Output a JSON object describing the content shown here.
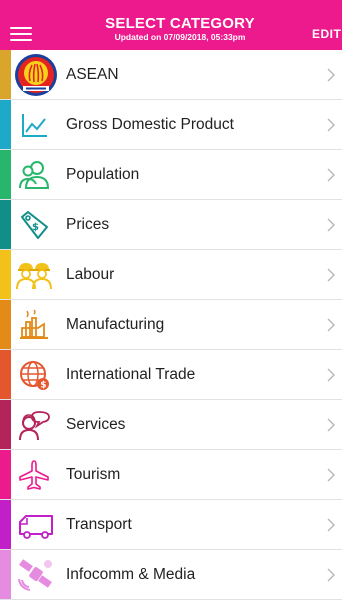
{
  "header": {
    "title": "SELECT CATEGORY",
    "subtitle": "Updated on 07/09/2018, 05:33pm",
    "edit_label": "EDIT",
    "menu_icon": "hamburger-menu-icon",
    "background": "#ec1a8c"
  },
  "categories": [
    {
      "label": "ASEAN",
      "icon": "asean-logo-icon",
      "accent": "#d9a62b"
    },
    {
      "label": "Gross Domestic Product",
      "icon": "line-chart-icon",
      "accent": "#1fa9c9"
    },
    {
      "label": "Population",
      "icon": "people-icon",
      "accent": "#27b66b"
    },
    {
      "label": "Prices",
      "icon": "price-tag-icon",
      "accent": "#0f8f88"
    },
    {
      "label": "Labour",
      "icon": "workers-icon",
      "accent": "#f2c21b"
    },
    {
      "label": "Manufacturing",
      "icon": "factory-icon",
      "accent": "#e38a17"
    },
    {
      "label": "International Trade",
      "icon": "globe-trade-icon",
      "accent": "#e4572e"
    },
    {
      "label": "Services",
      "icon": "customer-service-icon",
      "accent": "#b3245a"
    },
    {
      "label": "Tourism",
      "icon": "airplane-icon",
      "accent": "#ec1a8c"
    },
    {
      "label": "Transport",
      "icon": "bus-icon",
      "accent": "#c21fc9"
    },
    {
      "label": "Infocomm & Media",
      "icon": "satellite-icon",
      "accent": "#e58be0"
    }
  ]
}
